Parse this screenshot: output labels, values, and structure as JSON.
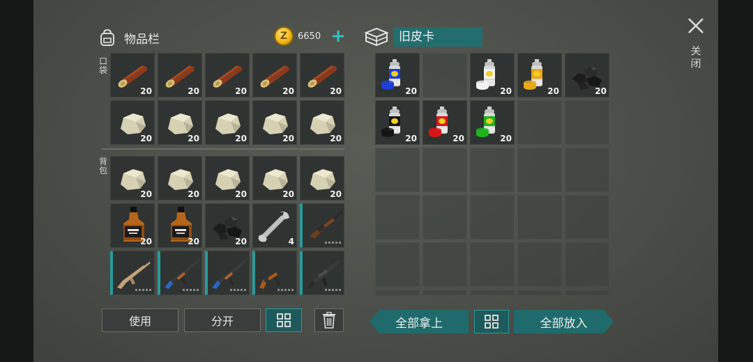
{
  "inventory": {
    "title": "物品栏",
    "coins": "6650",
    "pocket_label": "口袋",
    "backpack_label": "背包",
    "pocket": [
      {
        "item": "log-icon",
        "qty": "20"
      },
      {
        "item": "log-icon",
        "qty": "20"
      },
      {
        "item": "log-icon",
        "qty": "20"
      },
      {
        "item": "log-icon",
        "qty": "20"
      },
      {
        "item": "log-icon",
        "qty": "20"
      },
      {
        "item": "stone-icon",
        "qty": "20"
      },
      {
        "item": "stone-icon",
        "qty": "20"
      },
      {
        "item": "stone-icon",
        "qty": "20"
      },
      {
        "item": "stone-icon",
        "qty": "20"
      },
      {
        "item": "stone-icon",
        "qty": "20"
      }
    ],
    "backpack": [
      {
        "item": "stone-icon",
        "qty": "20"
      },
      {
        "item": "stone-icon",
        "qty": "20"
      },
      {
        "item": "stone-icon",
        "qty": "20"
      },
      {
        "item": "stone-icon",
        "qty": "20"
      },
      {
        "item": "stone-icon",
        "qty": "20"
      },
      {
        "item": "whiskey-bottle-icon",
        "qty": "20"
      },
      {
        "item": "whiskey-bottle-icon",
        "qty": "20"
      },
      {
        "item": "coal-icon",
        "qty": "20"
      },
      {
        "item": "wrench-icon",
        "qty": "4"
      },
      {
        "item": "shotgun-icon",
        "qty": ""
      },
      {
        "item": "tan-rifle-icon",
        "qty": ""
      },
      {
        "item": "ak-rifle-icon",
        "qty": ""
      },
      {
        "item": "ak-rifle-icon",
        "qty": ""
      },
      {
        "item": "smg-icon",
        "qty": ""
      },
      {
        "item": "assault-rifle-icon",
        "qty": ""
      }
    ]
  },
  "container": {
    "title": "旧皮卡",
    "slots": [
      {
        "item": "spray-can-blue-icon",
        "qty": "20"
      },
      {
        "item": "",
        "qty": ""
      },
      {
        "item": "spray-can-white-icon",
        "qty": "20"
      },
      {
        "item": "spray-can-yellow-icon",
        "qty": "20"
      },
      {
        "item": "coal-icon",
        "qty": "20"
      },
      {
        "item": "spray-can-black-icon",
        "qty": "20"
      },
      {
        "item": "spray-can-red-icon",
        "qty": "20"
      },
      {
        "item": "spray-can-green-icon",
        "qty": "20"
      },
      {
        "item": "",
        "qty": ""
      },
      {
        "item": "",
        "qty": ""
      }
    ]
  },
  "buttons": {
    "use": "使用",
    "split": "分开",
    "take_all": "全部拿上",
    "put_all": "全部放入"
  },
  "close_label": "关闭",
  "colors": {
    "accent": "#2a9a9a",
    "spray_blue": "#1d3fd8",
    "spray_white": "#f2f2f2",
    "spray_yellow": "#e8a818",
    "spray_black": "#151515",
    "spray_red": "#d81616",
    "spray_green": "#1eb51e"
  }
}
